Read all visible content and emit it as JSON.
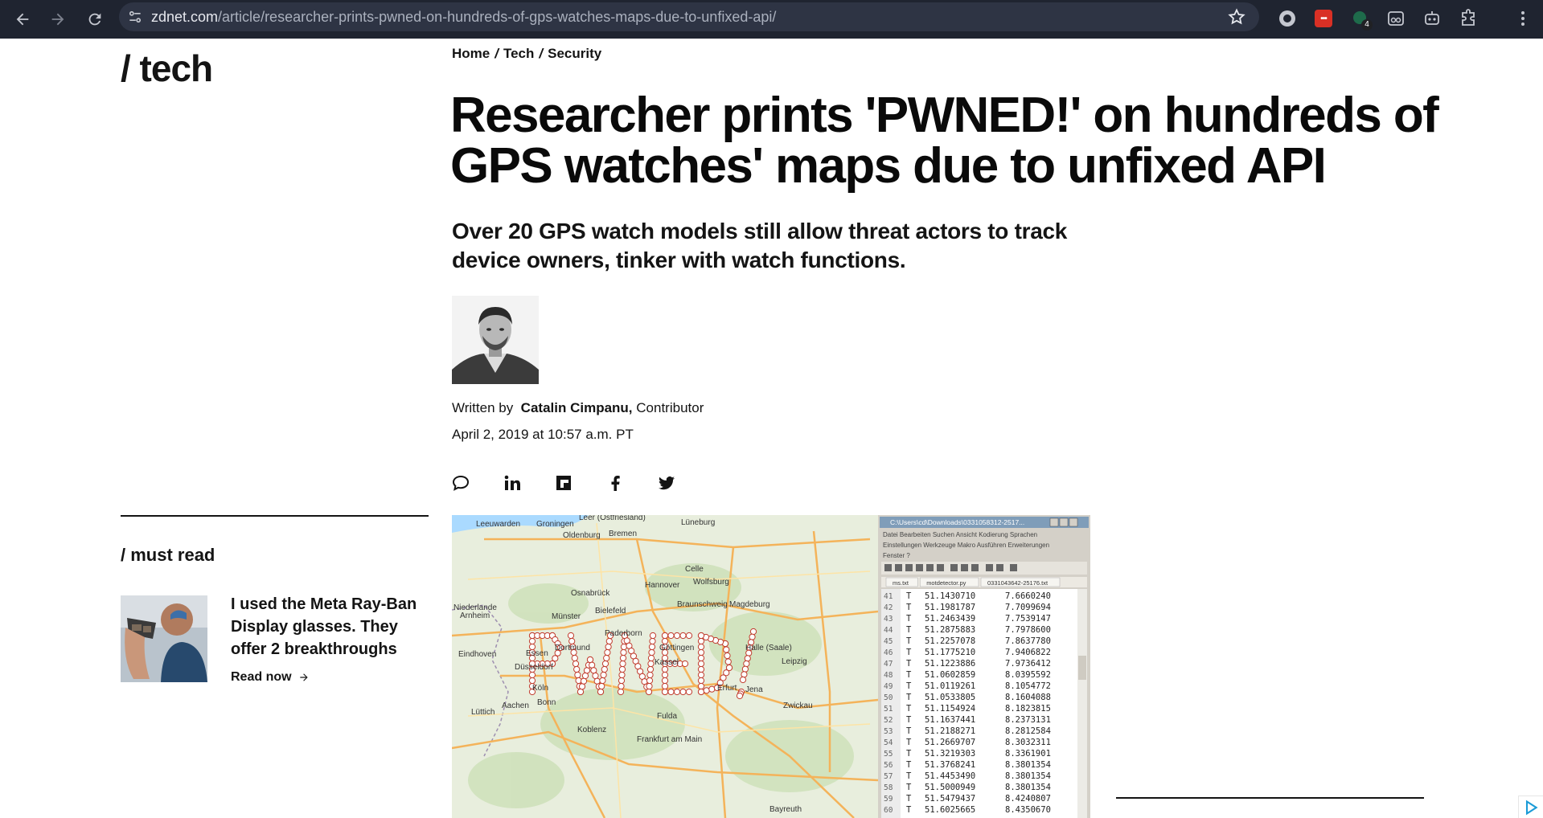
{
  "browser": {
    "url_host": "zdnet.com",
    "url_path": "/article/researcher-prints-pwned-on-hundreds-of-gps-watches-maps-due-to-unfixed-api/",
    "extension_badge_red": "•••",
    "extension_count": "4",
    "icons": [
      "back-icon",
      "forward-icon",
      "reload-icon",
      "site-info-icon",
      "bookmark-star-icon",
      "extension-icon",
      "profile-icon",
      "menu-icon"
    ]
  },
  "section": {
    "logo": "/ tech"
  },
  "breadcrumb": {
    "items": [
      "Home",
      "Tech",
      "Security"
    ],
    "separator": "/"
  },
  "article": {
    "headline": "Researcher prints 'PWNED!' on hundreds of GPS watches' maps due to unfixed API",
    "dek": "Over 20 GPS watch models still allow threat actors to track device owners, tinker with watch functions.",
    "byline_prefix": "Written by",
    "author": "Catalin Cimpanu,",
    "author_role": "Contributor",
    "date": "April 2, 2019 at 10:57 a.m. PT"
  },
  "share": {
    "icons": [
      "comment-icon",
      "linkedin-icon",
      "flipboard-icon",
      "facebook-icon",
      "twitter-icon"
    ]
  },
  "sidebar": {
    "heading": "/  must read",
    "item": {
      "title": "I used the Meta Ray-Ban Display glasses. They offer 2 breakthroughs",
      "cta": "Read now"
    }
  },
  "hero": {
    "map_text": "PWNED!",
    "cities": [
      "Groningen",
      "Bremen",
      "Oldenburg",
      "Lüneburg",
      "Hannover",
      "Wolfsburg",
      "Osnabrück",
      "Braunschweig",
      "Magdeburg",
      "Niederlande",
      "Bielefeld",
      "Münster",
      "Arnheim",
      "Paderborn",
      "Dortmund",
      "Eindhoven",
      "Essen",
      "Düsseldorf",
      "Köln",
      "Bonn",
      "Aachen",
      "Lüttich",
      "Koblenz",
      "Frankfurt am Main",
      "Kassel",
      "Göttingen",
      "Halle (Saale)",
      "Leipzig",
      "Erfurt",
      "Jena",
      "Zwickau",
      "Fulda",
      "Bayreuth",
      "Celle",
      "Leer (Ostfriesland)",
      "Leeuwarden"
    ],
    "editor_title": "C:\\Users\\cd\\Downloads\\0331058312-2517...",
    "editor_menu_1": [
      "Datei",
      "Bearbeiten",
      "Suchen",
      "Ansicht",
      "Kodierung",
      "Sprachen"
    ],
    "editor_menu_2": [
      "Einstellungen",
      "Werkzeuge",
      "Makro",
      "Ausführen",
      "Erweiterungen"
    ],
    "editor_menu_3": [
      "Fenster",
      "?"
    ],
    "editor_tabs": [
      "ms.txt",
      "motdetector.py",
      "0331043642-25176.txt"
    ],
    "editor_rows": [
      {
        "n": "41",
        "t": "T",
        "lat": "51.1430710",
        "lon": "7.6660240"
      },
      {
        "n": "42",
        "t": "T",
        "lat": "51.1981787",
        "lon": "7.7099694"
      },
      {
        "n": "43",
        "t": "T",
        "lat": "51.2463439",
        "lon": "7.7539147"
      },
      {
        "n": "44",
        "t": "T",
        "lat": "51.2875883",
        "lon": "7.7978600"
      },
      {
        "n": "45",
        "t": "T",
        "lat": "51.2257078",
        "lon": "7.8637780"
      },
      {
        "n": "46",
        "t": "T",
        "lat": "51.1775210",
        "lon": "7.9406822"
      },
      {
        "n": "47",
        "t": "T",
        "lat": "51.1223886",
        "lon": "7.9736412"
      },
      {
        "n": "48",
        "t": "T",
        "lat": "51.0602859",
        "lon": "8.0395592"
      },
      {
        "n": "49",
        "t": "T",
        "lat": "51.0119261",
        "lon": "8.1054772"
      },
      {
        "n": "50",
        "t": "T",
        "lat": "51.0533805",
        "lon": "8.1604088"
      },
      {
        "n": "51",
        "t": "T",
        "lat": "51.1154924",
        "lon": "8.1823815"
      },
      {
        "n": "52",
        "t": "T",
        "lat": "51.1637441",
        "lon": "8.2373131"
      },
      {
        "n": "53",
        "t": "T",
        "lat": "51.2188271",
        "lon": "8.2812584"
      },
      {
        "n": "54",
        "t": "T",
        "lat": "51.2669707",
        "lon": "8.3032311"
      },
      {
        "n": "55",
        "t": "T",
        "lat": "51.3219303",
        "lon": "8.3361901"
      },
      {
        "n": "56",
        "t": "T",
        "lat": "51.3768241",
        "lon": "8.3801354"
      },
      {
        "n": "57",
        "t": "T",
        "lat": "51.4453490",
        "lon": "8.3801354"
      },
      {
        "n": "58",
        "t": "T",
        "lat": "51.5000949",
        "lon": "8.3801354"
      },
      {
        "n": "59",
        "t": "T",
        "lat": "51.5479437",
        "lon": "8.4240807"
      },
      {
        "n": "60",
        "t": "T",
        "lat": "51.6025665",
        "lon": "8.4350670"
      }
    ]
  },
  "colors": {
    "chrome_bg": "#1f2430",
    "omnibox_bg": "#2e3444",
    "text": "#141414",
    "pwned_red": "#c0392b"
  }
}
